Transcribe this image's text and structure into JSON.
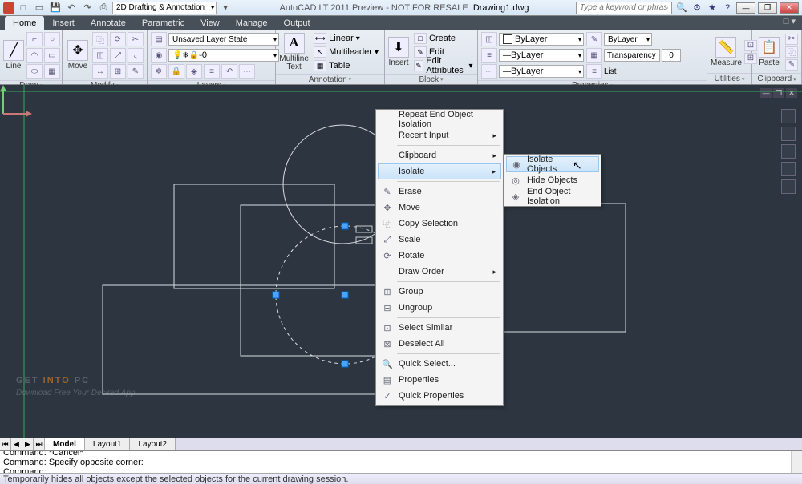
{
  "titlebar": {
    "workspace": "2D Drafting & Annotation",
    "app_title": "AutoCAD LT 2011 Preview - NOT FOR RESALE",
    "doc_title": "Drawing1.dwg",
    "search_placeholder": "Type a keyword or phrase"
  },
  "ribbon_tabs": [
    "Home",
    "Insert",
    "Annotate",
    "Parametric",
    "View",
    "Manage",
    "Output"
  ],
  "ribbon": {
    "draw": {
      "title": "Draw",
      "line_label": "Line"
    },
    "modify": {
      "title": "Modify",
      "move_label": "Move"
    },
    "layers": {
      "title": "Layers",
      "unsaved": "Unsaved Layer State",
      "current": "0"
    },
    "annotation": {
      "title": "Annotation",
      "mtext_label": "Multiline Text",
      "linear": "Linear",
      "multileader": "Multileader",
      "table": "Table"
    },
    "block": {
      "title": "Block",
      "insert_label": "Insert",
      "create": "Create",
      "edit": "Edit",
      "edit_attr": "Edit Attributes"
    },
    "properties": {
      "title": "Properties",
      "color": "ByLayer",
      "lineweight": "ByLayer",
      "linetype": "ByLayer",
      "bylayer_btn": "ByLayer",
      "transparency_label": "Transparency",
      "transparency_value": "0",
      "list": "List"
    },
    "utilities": {
      "title": "Utilities",
      "measure_label": "Measure"
    },
    "clipboard": {
      "title": "Clipboard",
      "paste_label": "Paste"
    }
  },
  "context_menu": {
    "repeat": "Repeat End Object Isolation",
    "recent": "Recent Input",
    "clipboard": "Clipboard",
    "isolate": "Isolate",
    "erase": "Erase",
    "move": "Move",
    "copy": "Copy Selection",
    "scale": "Scale",
    "rotate": "Rotate",
    "draw_order": "Draw Order",
    "group": "Group",
    "ungroup": "Ungroup",
    "select_similar": "Select Similar",
    "deselect": "Deselect All",
    "quick_select": "Quick Select...",
    "properties": "Properties",
    "quick_props": "Quick Properties"
  },
  "isolate_submenu": {
    "isolate_objects": "Isolate Objects",
    "hide_objects": "Hide Objects",
    "end_isolation": "End Object Isolation"
  },
  "model_tabs": {
    "model": "Model",
    "layout1": "Layout1",
    "layout2": "Layout2"
  },
  "command": {
    "line1": "Command: *Cancel*",
    "line2": "Command: Specify opposite corner:",
    "prompt": "Command:"
  },
  "statusbar": {
    "hint": "Temporarily hides all objects except the selected objects for the current drawing session."
  },
  "watermark": {
    "get": "GET ",
    "into": "INTO",
    "pc": " PC",
    "tagline": "Download Free Your Desired App"
  }
}
